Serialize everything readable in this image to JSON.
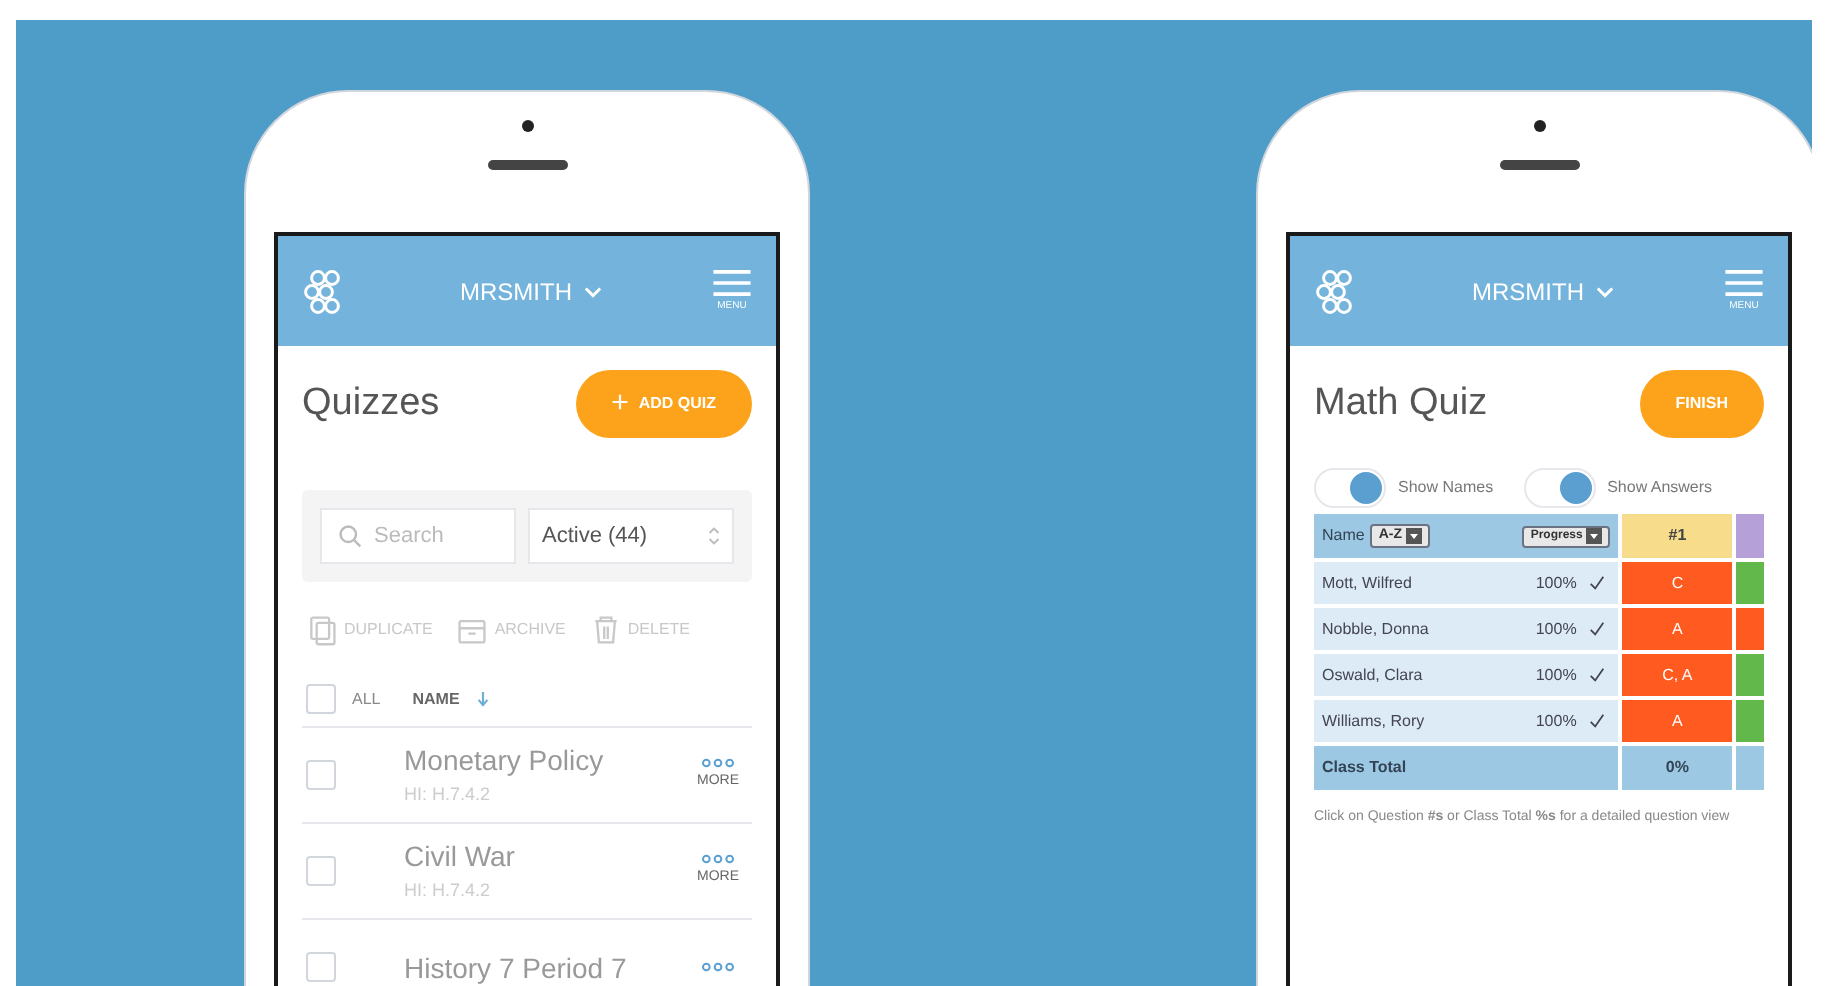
{
  "phones": [
    {
      "header": {
        "user": "MRSMITH",
        "menu_label": "MENU"
      },
      "title": "Quizzes",
      "action_button": {
        "icon": "+",
        "label": "ADD QUIZ"
      },
      "kind": "list",
      "search": {
        "placeholder": "Search"
      },
      "filter": "Active (44)",
      "toolbar": [
        {
          "label": "DUPLICATE",
          "kind": "copy"
        },
        {
          "label": "ARCHIVE",
          "kind": "archive"
        },
        {
          "label": "DELETE",
          "kind": "trash"
        }
      ],
      "list_header": {
        "all": "ALL",
        "name": "NAME",
        "all_checked": false
      },
      "quizzes": [
        {
          "title": "Monetary Policy",
          "subtitle": "HI: H.7.4.2",
          "more": "MORE",
          "checked": false
        },
        {
          "title": "Civil War",
          "subtitle": "HI: H.7.4.2",
          "more": "MORE",
          "checked": false
        },
        {
          "title": "History 7 Period 7",
          "checked": false
        }
      ]
    },
    {
      "header": {
        "user": "MRSMITH",
        "menu_label": "MENU"
      },
      "title": "Math Quiz",
      "action_button": {
        "label": "FINISH"
      },
      "kind": "results",
      "toggles": [
        {
          "label": "Show Names",
          "on": true
        },
        {
          "label": "Show Answers",
          "on": true
        }
      ],
      "table": {
        "name_header": "Name",
        "sort": "A-Z",
        "progress_header": "Progress",
        "question_header": "#1",
        "rows": [
          {
            "name": "Mott, Wilfred",
            "progress": "100%",
            "done": true,
            "answers": [
              {
                "text": "C",
                "color": "#ff5a1f"
              },
              {
                "color": "#62b84a"
              }
            ]
          },
          {
            "name": "Nobble, Donna",
            "progress": "100%",
            "done": true,
            "answers": [
              {
                "text": "A",
                "color": "#ff5a1f"
              },
              {
                "color": "#ff5a1f"
              }
            ]
          },
          {
            "name": "Oswald, Clara",
            "progress": "100%",
            "done": true,
            "answers": [
              {
                "text": "C, A",
                "color": "#ff5a1f"
              },
              {
                "color": "#62b84a"
              }
            ]
          },
          {
            "name": "Williams, Rory",
            "progress": "100%",
            "done": true,
            "answers": [
              {
                "text": "A",
                "color": "#ff5a1f"
              },
              {
                "color": "#62b84a"
              }
            ]
          }
        ],
        "total_label": "Class Total",
        "total_value": "0%"
      },
      "note": "Click on Question **#s** or Class Total **%s** for a detailed question view"
    }
  ]
}
